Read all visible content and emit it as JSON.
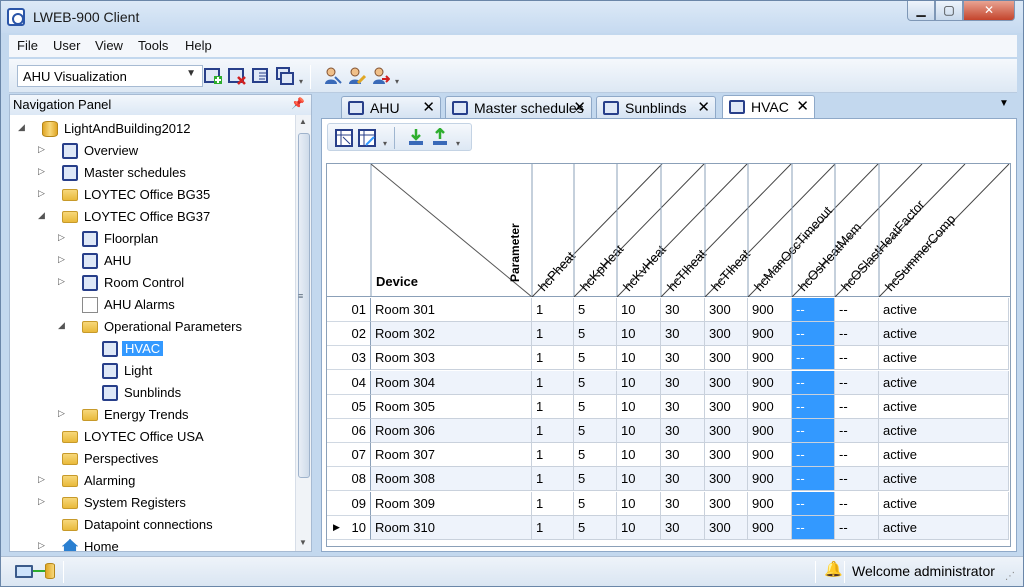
{
  "window": {
    "title": "LWEB-900 Client",
    "min": "▁",
    "max": "▢",
    "close": "✕"
  },
  "menu": [
    "File",
    "User",
    "View",
    "Tools",
    "Help"
  ],
  "toolbar": {
    "view_select": "AHU Visualization"
  },
  "nav": {
    "title": "Navigation Panel",
    "items": [
      {
        "label": "LightAndBuilding2012",
        "level": 0,
        "icon": "database-icon",
        "exp": "◢"
      },
      {
        "label": "Overview",
        "level": 1,
        "icon": "view-icon",
        "exp": "▷"
      },
      {
        "label": "Master schedules",
        "level": 1,
        "icon": "schedule-icon",
        "exp": "▷"
      },
      {
        "label": "LOYTEC Office BG35",
        "level": 1,
        "icon": "folder-icon",
        "exp": "▷"
      },
      {
        "label": "LOYTEC Office BG37",
        "level": 1,
        "icon": "folder-icon",
        "exp": "◢"
      },
      {
        "label": "Floorplan",
        "level": 2,
        "icon": "view-icon",
        "exp": "▷"
      },
      {
        "label": "AHU",
        "level": 2,
        "icon": "view-icon",
        "exp": "▷"
      },
      {
        "label": "Room Control",
        "level": 2,
        "icon": "view-icon",
        "exp": "▷"
      },
      {
        "label": "AHU Alarms",
        "level": 2,
        "icon": "alarm-icon",
        "exp": ""
      },
      {
        "label": "Operational Parameters",
        "level": 2,
        "icon": "folder-icon",
        "exp": "◢"
      },
      {
        "label": "HVAC",
        "level": 3,
        "icon": "parameter-view-icon",
        "exp": "",
        "selected": true
      },
      {
        "label": "Light",
        "level": 3,
        "icon": "parameter-view-icon",
        "exp": ""
      },
      {
        "label": "Sunblinds",
        "level": 3,
        "icon": "parameter-view-icon",
        "exp": ""
      },
      {
        "label": "Energy Trends",
        "level": 2,
        "icon": "folder-icon",
        "exp": "▷"
      },
      {
        "label": "LOYTEC Office USA",
        "level": 1,
        "icon": "folder-icon",
        "exp": ""
      },
      {
        "label": "Perspectives",
        "level": 1,
        "icon": "folder-icon",
        "exp": ""
      },
      {
        "label": "Alarming",
        "level": 1,
        "icon": "folder-icon",
        "exp": "▷"
      },
      {
        "label": "System Registers",
        "level": 1,
        "icon": "folder-icon",
        "exp": "▷"
      },
      {
        "label": "Datapoint connections",
        "level": 1,
        "icon": "folder-icon",
        "exp": ""
      },
      {
        "label": "Home",
        "level": 1,
        "icon": "home-icon",
        "exp": "▷"
      }
    ]
  },
  "tabs": [
    {
      "label": "AHU",
      "close": "✕"
    },
    {
      "label": "Master schedules",
      "close": "✕"
    },
    {
      "label": "Sunblinds",
      "close": "✕"
    },
    {
      "label": "HVAC",
      "close": "✕",
      "active": true
    }
  ],
  "grid": {
    "corner_device": "Device",
    "corner_parameter": "Parameter",
    "columns": [
      "hcPheat",
      "hcKpHeat",
      "hcKvHeat",
      "hcTIheat",
      "hcTIheat",
      "hcManOccTimeout",
      "hcOsHeatMem",
      "hcOSlastHeatFactor",
      "hcSummerComp"
    ],
    "rows": [
      {
        "num": "01",
        "device": "Room 301",
        "values": [
          "1",
          "5",
          "10",
          "30",
          "300",
          "900",
          "--",
          "--",
          "active"
        ]
      },
      {
        "num": "02",
        "device": "Room 302",
        "values": [
          "1",
          "5",
          "10",
          "30",
          "300",
          "900",
          "--",
          "--",
          "active"
        ]
      },
      {
        "num": "03",
        "device": "Room 303",
        "values": [
          "1",
          "5",
          "10",
          "30",
          "300",
          "900",
          "--",
          "--",
          "active"
        ]
      },
      {
        "num": "04",
        "device": "Room 304",
        "values": [
          "1",
          "5",
          "10",
          "30",
          "300",
          "900",
          "--",
          "--",
          "active"
        ]
      },
      {
        "num": "05",
        "device": "Room 305",
        "values": [
          "1",
          "5",
          "10",
          "30",
          "300",
          "900",
          "--",
          "--",
          "active"
        ]
      },
      {
        "num": "06",
        "device": "Room 306",
        "values": [
          "1",
          "5",
          "10",
          "30",
          "300",
          "900",
          "--",
          "--",
          "active"
        ]
      },
      {
        "num": "07",
        "device": "Room 307",
        "values": [
          "1",
          "5",
          "10",
          "30",
          "300",
          "900",
          "--",
          "--",
          "active"
        ]
      },
      {
        "num": "08",
        "device": "Room 308",
        "values": [
          "1",
          "5",
          "10",
          "30",
          "300",
          "900",
          "--",
          "--",
          "active"
        ]
      },
      {
        "num": "09",
        "device": "Room 309",
        "values": [
          "1",
          "5",
          "10",
          "30",
          "300",
          "900",
          "--",
          "--",
          "active"
        ]
      },
      {
        "num": "10",
        "device": "Room 310",
        "values": [
          "1",
          "5",
          "10",
          "30",
          "300",
          "900",
          "--",
          "--",
          "active"
        ],
        "current": true
      }
    ],
    "highlight_column": 6,
    "current_row_marker": "▶"
  },
  "status": {
    "message": "Welcome administrator"
  },
  "colors": {
    "selection": "#3399ff",
    "window_frame": "#c3d8ee"
  }
}
